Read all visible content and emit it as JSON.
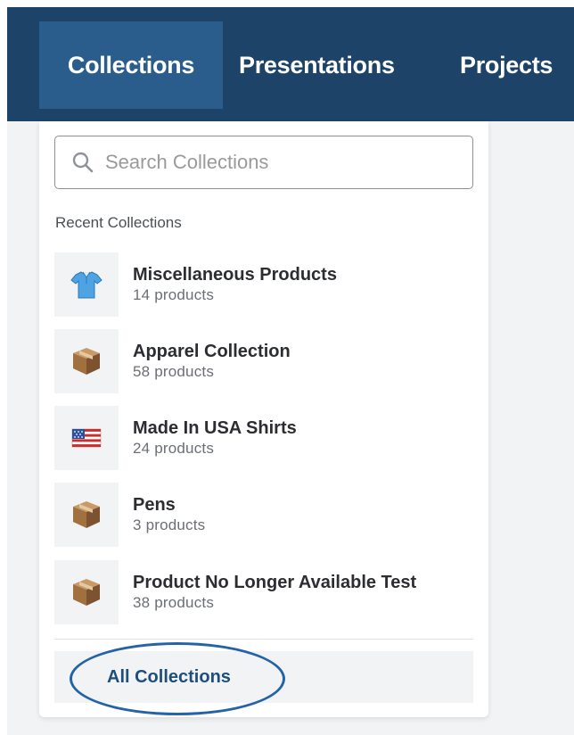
{
  "nav": {
    "tabs": [
      {
        "label": "Collections",
        "active": true
      },
      {
        "label": "Presentations",
        "active": false
      },
      {
        "label": "Projects",
        "active": false
      }
    ]
  },
  "search": {
    "placeholder": "Search Collections",
    "value": ""
  },
  "recent": {
    "heading": "Recent Collections",
    "items": [
      {
        "name": "Miscellaneous Products",
        "count": "14 products",
        "icon": "shirt-icon"
      },
      {
        "name": "Apparel Collection",
        "count": "58 products",
        "icon": "box-icon"
      },
      {
        "name": "Made In USA Shirts",
        "count": "24 products",
        "icon": "usa-flag-icon"
      },
      {
        "name": "Pens",
        "count": "3 products",
        "icon": "box-icon"
      },
      {
        "name": "Product No Longer Available Test",
        "count": "38 products",
        "icon": "box-icon"
      }
    ]
  },
  "footer": {
    "all_label": "All Collections"
  },
  "colors": {
    "navbar": "#1d4468",
    "active_tab": "#2a5d8c",
    "link": "#1e4e7d",
    "highlight_ring": "#2563a8"
  }
}
